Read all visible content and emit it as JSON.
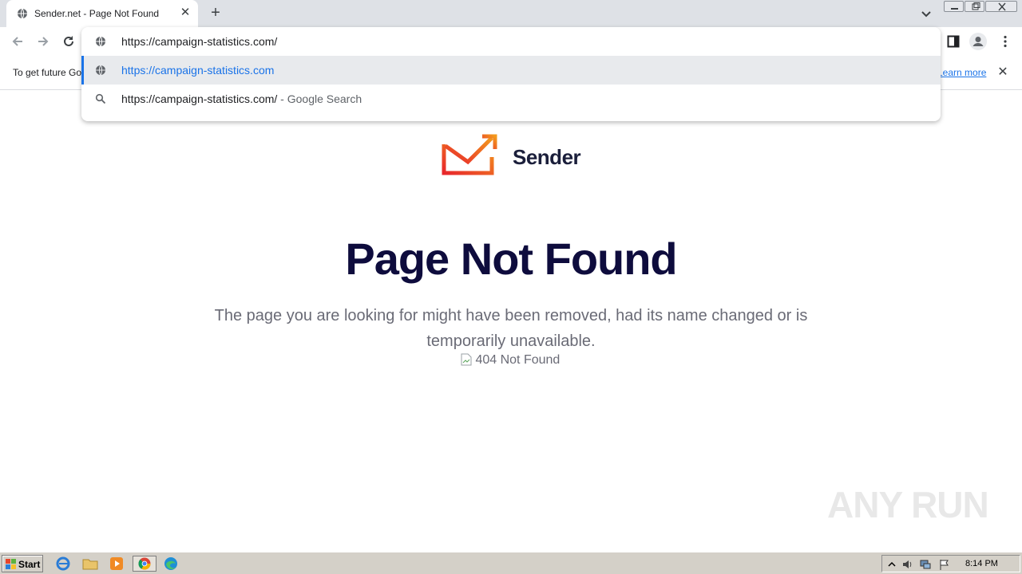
{
  "browser": {
    "tab": {
      "title": "Sender.net - Page Not Found",
      "close_symbol": "✕"
    },
    "new_tab_symbol": "+",
    "omnibox": {
      "input_value": "https://campaign-statistics.com/",
      "suggestions": [
        {
          "text": "https://campaign-statistics.com",
          "icon": "globe-icon"
        },
        {
          "query": "https://campaign-statistics.com/",
          "suffix": " - Google Search",
          "icon": "search-icon"
        }
      ]
    },
    "infobar": {
      "text": "To get future Google Chrome updates",
      "link": "Learn more",
      "close_symbol": "✕"
    }
  },
  "page": {
    "logo_text": "Sender",
    "heading": "Page Not Found",
    "description": "The page you are looking for might have been removed, had its name changed or is temporarily unavailable.",
    "broken_image_alt": "404 Not Found"
  },
  "watermark": "ANY RUN",
  "taskbar": {
    "start_label": "Start",
    "clock": "8:14 PM",
    "apps": [
      "ie-icon",
      "folder-icon",
      "media-player-icon",
      "chrome-icon",
      "edge-icon"
    ]
  },
  "colors": {
    "heading": "#0e0c3d",
    "body_text": "#6a6b76",
    "logo_red": "#e8272b",
    "logo_orange": "#f39a1d",
    "link_blue": "#1a73e8"
  }
}
